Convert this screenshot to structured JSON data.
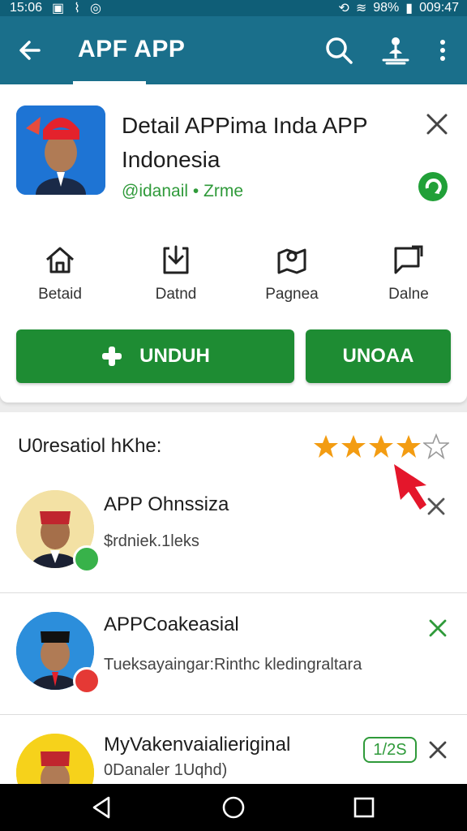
{
  "status": {
    "time": "15:06",
    "battery": "98%",
    "clock": "009:47"
  },
  "toolbar": {
    "title": "APF APP"
  },
  "app": {
    "title": "Detail APPima Inda APP Indonesia",
    "subtitle": "@idanail • Zrme"
  },
  "actions": [
    {
      "label": "Betaid",
      "icon": "home-icon"
    },
    {
      "label": "Datnd",
      "icon": "download-icon"
    },
    {
      "label": "Pagnea",
      "icon": "map-book-icon"
    },
    {
      "label": "Dalne",
      "icon": "chat-share-icon"
    }
  ],
  "buttons": {
    "primary": "UNDUH",
    "secondary": "UNOAA"
  },
  "section": {
    "title": "U0resatiol hKhe:"
  },
  "rating": {
    "value": 4,
    "max": 5
  },
  "list": [
    {
      "name": "APP Ohnssiza",
      "detail": "$rdniek.1leks",
      "badge_color": "#38b24a"
    },
    {
      "name": "APPCoakeasial",
      "detail": "Tueksayaingar:Rinthc kledingraltara",
      "badge_color": "#e53935"
    },
    {
      "name": "MyVakenvaialieriginal",
      "detail": "0Danaler 1Uqhd)",
      "tag": "1/2S"
    }
  ],
  "colors": {
    "primary": "#1a6f8b",
    "accent": "#1e8c33",
    "star": "#f39c12",
    "cursor": "#e4162b"
  }
}
